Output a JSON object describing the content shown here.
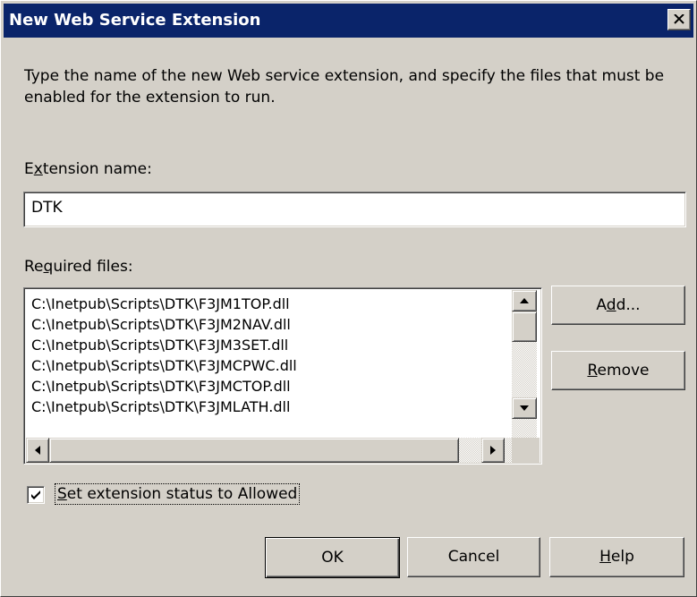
{
  "window": {
    "title": "New Web Service Extension",
    "close_icon": "close-x-icon"
  },
  "description": "Type the name of the new Web service extension, and specify the files that must be enabled for the extension to run.",
  "extension_name": {
    "label_pre": "E",
    "label_accel": "x",
    "label_post": "tension name:",
    "value": "DTK"
  },
  "required_files": {
    "label_pre": "Re",
    "label_accel": "q",
    "label_post": "uired files:",
    "items": [
      "C:\\Inetpub\\Scripts\\DTK\\F3JM1TOP.dll",
      "C:\\Inetpub\\Scripts\\DTK\\F3JM2NAV.dll",
      "C:\\Inetpub\\Scripts\\DTK\\F3JM3SET.dll",
      "C:\\Inetpub\\Scripts\\DTK\\F3JMCPWC.dll",
      "C:\\Inetpub\\Scripts\\DTK\\F3JMCTOP.dll",
      "C:\\Inetpub\\Scripts\\DTK\\F3JMLATH.dll"
    ]
  },
  "buttons": {
    "add_pre": "A",
    "add_accel": "d",
    "add_post": "d...",
    "remove_accel": "R",
    "remove_post": "emove",
    "ok": "OK",
    "cancel": "Cancel",
    "help_accel": "H",
    "help_post": "elp"
  },
  "allowed_checkbox": {
    "label_accel": "S",
    "label_post": "et extension status to Allowed",
    "checked": true
  },
  "colors": {
    "titlebar": "#0a246a",
    "face": "#d4d0c8"
  }
}
